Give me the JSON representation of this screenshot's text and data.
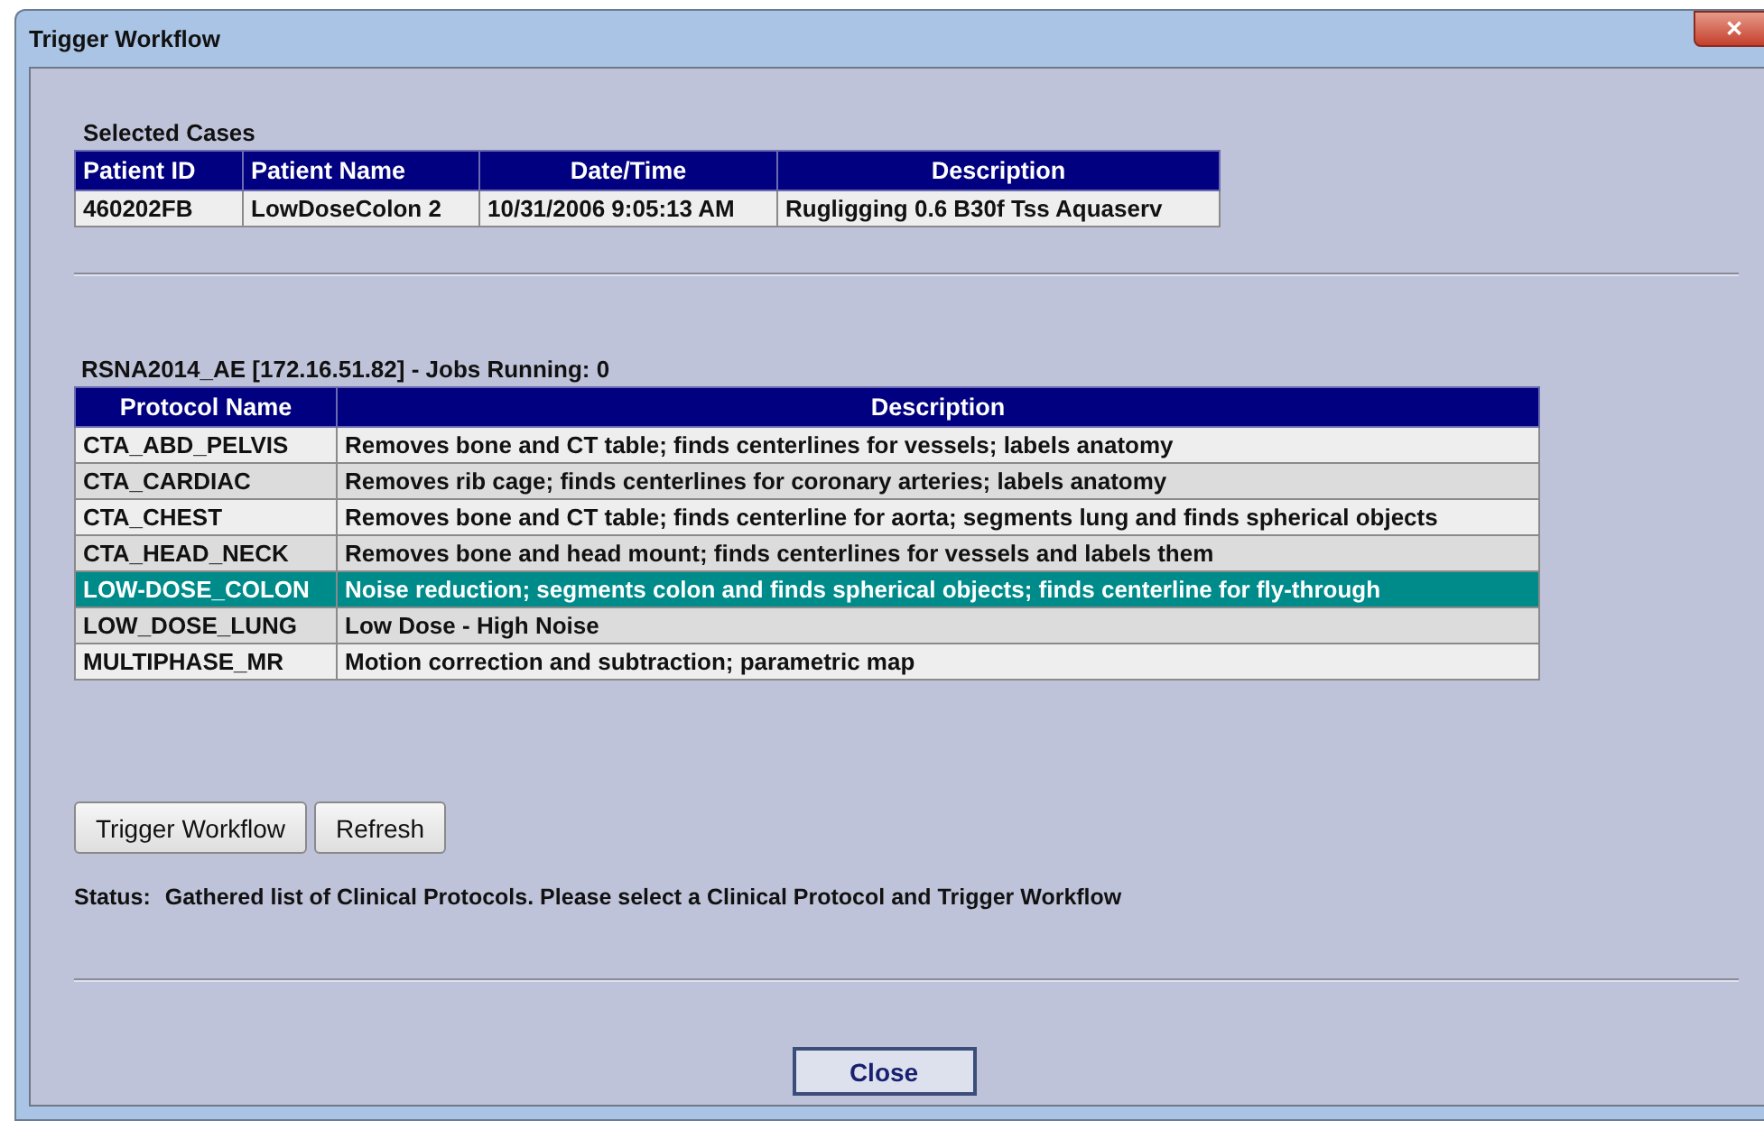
{
  "window": {
    "title": "Trigger Workflow",
    "close_glyph": "✕"
  },
  "selected_cases": {
    "label": "Selected Cases",
    "columns": [
      "Patient ID",
      "Patient Name",
      "Date/Time",
      "Description"
    ],
    "rows": [
      [
        "460202FB",
        "LowDoseColon 2",
        "10/31/2006 9:05:13 AM",
        "Rugligging 0.6 B30f Tss Aquaserv"
      ]
    ]
  },
  "protocols": {
    "label": "RSNA2014_AE [172.16.51.82] - Jobs Running: 0",
    "columns": [
      "Protocol Name",
      "Description"
    ],
    "rows": [
      {
        "name": "CTA_ABD_PELVIS",
        "description": "Removes bone and CT table; finds centerlines for vessels; labels anatomy",
        "selected": false
      },
      {
        "name": "CTA_CARDIAC",
        "description": "Removes rib cage; finds centerlines for coronary arteries; labels anatomy",
        "selected": false
      },
      {
        "name": "CTA_CHEST",
        "description": "Removes bone and CT table; finds centerline for aorta; segments lung and finds spherical objects",
        "selected": false
      },
      {
        "name": "CTA_HEAD_NECK",
        "description": "Removes bone and head mount; finds centerlines for vessels and labels them",
        "selected": false
      },
      {
        "name": "LOW-DOSE_COLON",
        "description": "Noise reduction; segments colon and finds spherical objects; finds centerline for fly-through",
        "selected": true
      },
      {
        "name": "LOW_DOSE_LUNG",
        "description": "Low Dose - High Noise",
        "selected": false
      },
      {
        "name": "MULTIPHASE_MR",
        "description": "Motion correction and subtraction; parametric map",
        "selected": false
      }
    ]
  },
  "buttons": [
    "Trigger Workflow",
    "Refresh"
  ],
  "status": {
    "label": "Status:",
    "text": "Gathered list of Clinical Protocols. Please select a Clinical Protocol and Trigger Workflow"
  },
  "close_button": "Close"
}
